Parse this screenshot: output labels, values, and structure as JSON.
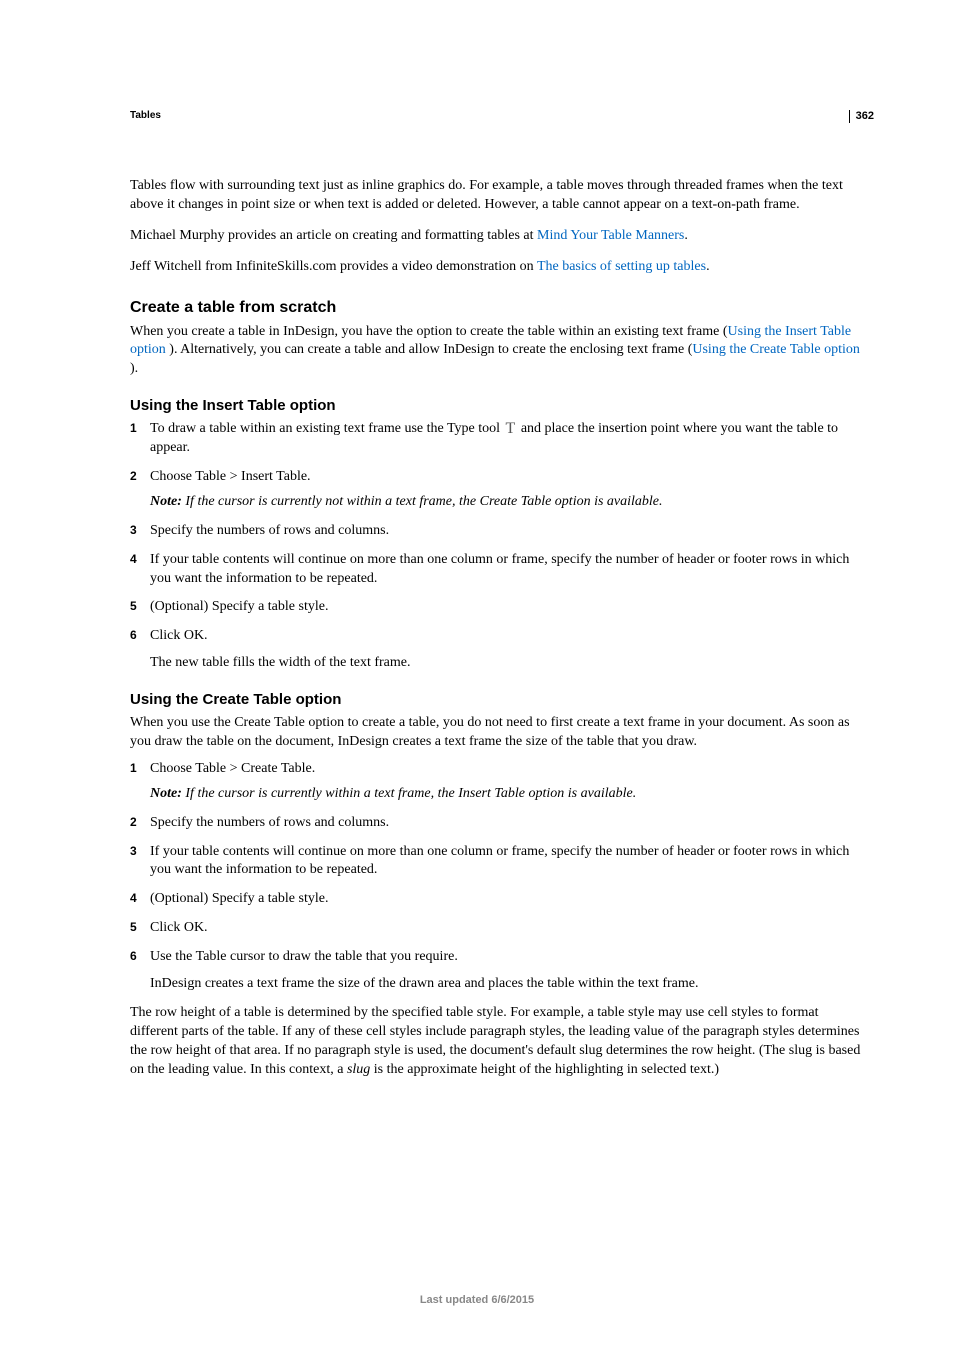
{
  "page_number": "362",
  "running_head": "Tables",
  "intro": {
    "p1": "Tables flow with surrounding text just as inline graphics do. For example, a table moves through threaded frames when the text above it changes in point size or when text is added or deleted. However, a table cannot appear on a text-on-path frame.",
    "p2_pre": "Michael Murphy provides an article on creating and formatting tables at ",
    "p2_link": "Mind Your Table Manners",
    "p2_post": ".",
    "p3_pre": "Jeff Witchell from InfiniteSkills.com provides a video demonstration on ",
    "p3_link": "The basics of setting up tables",
    "p3_post": "."
  },
  "section_scratch": {
    "heading": "Create a table from scratch",
    "body_pre": "When you create a table in InDesign, you have the option to create the table within an existing text frame (",
    "link1": "Using the Insert Table option ",
    "body_mid": "). Alternatively, you can create a table and allow InDesign to create the enclosing text frame (",
    "link2": "Using the Create Table option ",
    "body_post": ")."
  },
  "section_insert": {
    "heading": "Using the Insert Table option",
    "step1_pre": "To draw a table within an existing text frame use the Type tool ",
    "step1_post": " and place the insertion point where you want the table to appear.",
    "step2": "Choose Table > Insert Table.",
    "note_label": "Note: ",
    "note_text": "If the cursor is currently not within a text frame, the Create Table option is available.",
    "step3": "Specify the numbers of rows and columns.",
    "step4": "If your table contents will continue on more than one column or frame, specify the number of header or footer rows in which you want the information to be repeated.",
    "step5": "(Optional) Specify a table style.",
    "step6": "Click OK.",
    "after": "The new table fills the width of the text frame."
  },
  "section_create": {
    "heading": "Using the Create Table option",
    "intro": "When you use the Create Table option to create a table, you do not need to first create a text frame in your document. As soon as you draw the table on the document, InDesign creates a text frame the size of the table that you draw.",
    "step1": "Choose Table > Create Table.",
    "note_label": "Note: ",
    "note_text": "If the cursor is currently within a text frame, the Insert Table option is available.",
    "step2": "Specify the numbers of rows and columns.",
    "step3": "If your table contents will continue on more than one column or frame, specify the number of header or footer rows in which you want the information to be repeated.",
    "step4": "(Optional) Specify a table style.",
    "step5": "Click OK.",
    "step6": "Use the Table cursor to draw the table that you require.",
    "after": "InDesign creates a text frame the size of the drawn area and places the table within the text frame."
  },
  "closing": {
    "p_pre": "The row height of a table is determined by the specified table style. For example, a table style may use cell styles to format different parts of the table. If any of these cell styles include paragraph styles, the leading value of the paragraph styles determines the row height of that area. If no paragraph style is used, the document's default slug determines the row height. (The slug is based on the leading value. In this context, a ",
    "term": "slug",
    "p_post": " is the approximate height of the highlighting in selected text.)"
  },
  "footer": "Last updated 6/6/2015"
}
